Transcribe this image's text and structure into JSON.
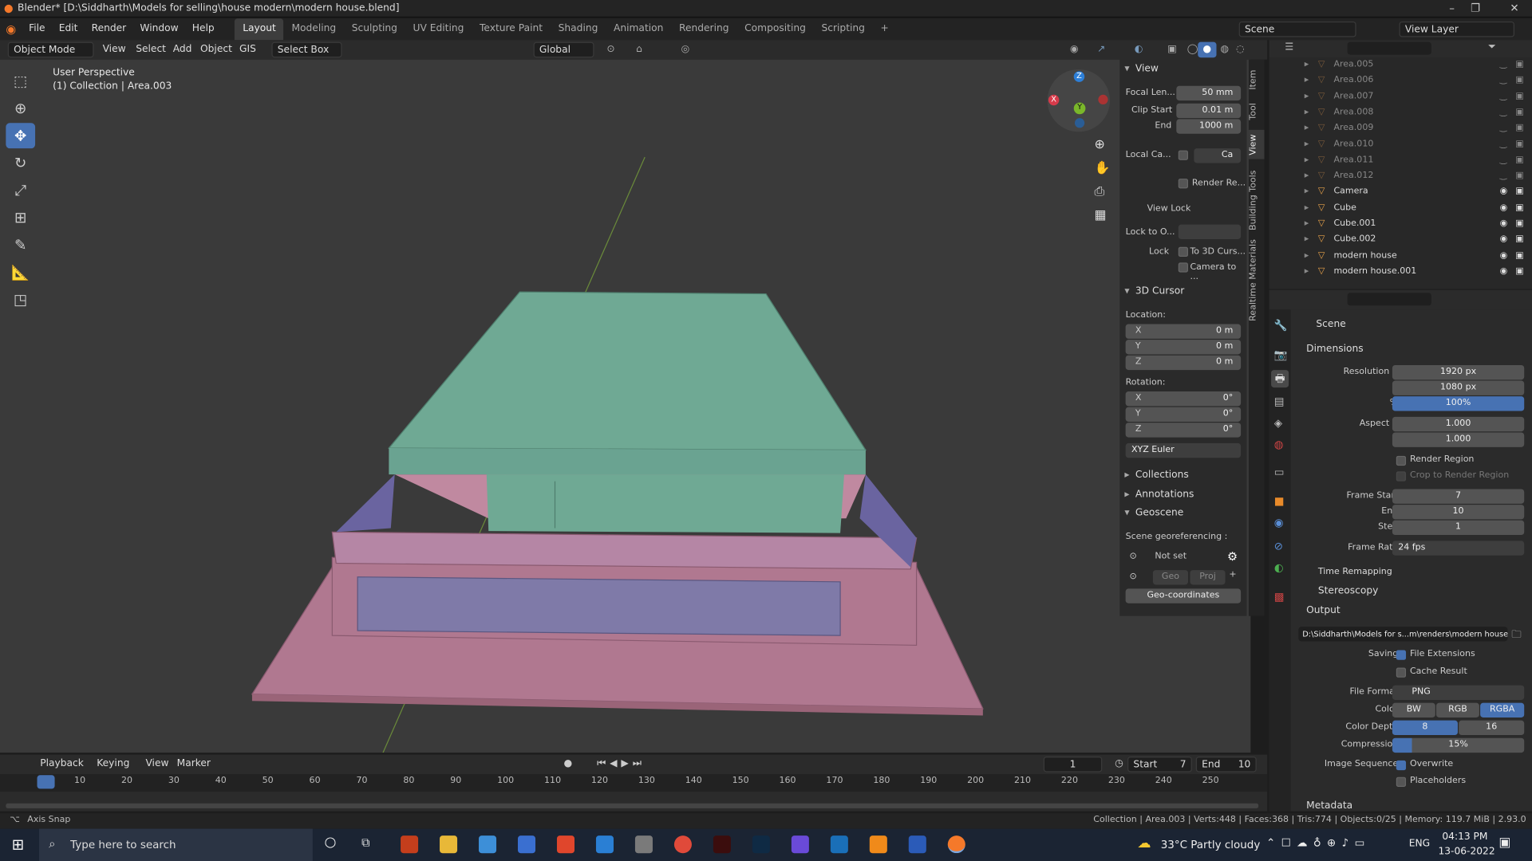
{
  "window": {
    "title": "Blender* [D:\\Siddharth\\Models for selling\\house modern\\modern house.blend]"
  },
  "menu": [
    "File",
    "Edit",
    "Render",
    "Window",
    "Help"
  ],
  "workspaces": [
    "Layout",
    "Modeling",
    "Sculpting",
    "UV Editing",
    "Texture Paint",
    "Shading",
    "Animation",
    "Rendering",
    "Compositing",
    "Scripting"
  ],
  "scene_label": "Scene",
  "view_layer_label": "View Layer",
  "header": {
    "mode": "Object Mode",
    "view": "View",
    "select": "Select",
    "add": "Add",
    "object": "Object",
    "gis": "GIS",
    "select_box": "Select Box",
    "orientation": "Global"
  },
  "viewport": {
    "perspective": "User Perspective",
    "collection": "(1) Collection | Area.003"
  },
  "npanel": {
    "tabs": [
      "Item",
      "Tool",
      "View",
      "Building Tools",
      "Realtime Materials"
    ],
    "view_title": "View",
    "focal_label": "Focal Len...",
    "focal": "50 mm",
    "clip_start_label": "Clip Start",
    "clip_start": "0.01 m",
    "end_label": "End",
    "clip_end": "1000 m",
    "local_cam_label": "Local Ca...",
    "local_cam_val": "Ca",
    "render_region": "Render Re...",
    "view_lock": "View Lock",
    "lock_to_label": "Lock to O...",
    "lock_label": "Lock",
    "to_cursor": "To 3D Curs...",
    "camera_to": "Camera to ...",
    "cursor_title": "3D Cursor",
    "location": "Location:",
    "rotation": "Rotation:",
    "x": "X",
    "y": "Y",
    "z": "Z",
    "zero_m": "0 m",
    "zero_deg": "0°",
    "euler": "XYZ Euler",
    "collections": "Collections",
    "annotations": "Annotations",
    "geoscene": "Geoscene",
    "georef": "Scene georeferencing :",
    "not_set": "Not set",
    "geo": "Geo",
    "proj": "Proj",
    "geo_coords": "Geo-coordinates"
  },
  "outliner": {
    "items": [
      {
        "name": "Area.005",
        "vis": false
      },
      {
        "name": "Area.006",
        "vis": false
      },
      {
        "name": "Area.007",
        "vis": false
      },
      {
        "name": "Area.008",
        "vis": false
      },
      {
        "name": "Area.009",
        "vis": false
      },
      {
        "name": "Area.010",
        "vis": false
      },
      {
        "name": "Area.011",
        "vis": false
      },
      {
        "name": "Area.012",
        "vis": false
      },
      {
        "name": "Camera",
        "vis": true
      },
      {
        "name": "Cube",
        "vis": true
      },
      {
        "name": "Cube.001",
        "vis": true
      },
      {
        "name": "Cube.002",
        "vis": true
      },
      {
        "name": "modern house",
        "vis": true
      },
      {
        "name": "modern house.001",
        "vis": true
      }
    ]
  },
  "props": {
    "scene": "Scene",
    "dimensions": "Dimensions",
    "res_x_label": "Resolution X",
    "res_x": "1920 px",
    "y_label": "Y",
    "res_y": "1080 px",
    "pct_label": "%",
    "pct": "100%",
    "aspect_x_label": "Aspect X",
    "aspect_x": "1.000",
    "aspect_y": "1.000",
    "render_region": "Render Region",
    "crop": "Crop to Render Region",
    "frame_start_label": "Frame Start",
    "frame_start": "7",
    "end_label": "End",
    "frame_end": "10",
    "step_label": "Step",
    "step": "1",
    "frame_rate_label": "Frame Rate",
    "frame_rate": "24 fps",
    "time_remap": "Time Remapping",
    "stereo": "Stereoscopy",
    "output": "Output",
    "path": "D:\\Siddharth\\Models for s...m\\renders\\modern house",
    "saving": "Saving",
    "file_ext": "File Extensions",
    "cache": "Cache Result",
    "file_format_label": "File Format",
    "file_format": "PNG",
    "color_label": "Color",
    "bw": "BW",
    "rgb": "RGB",
    "rgba": "RGBA",
    "depth_label": "Color Depth",
    "d8": "8",
    "d16": "16",
    "compression_label": "Compression",
    "compression": "15%",
    "imgseq_label": "Image Sequence",
    "overwrite": "Overwrite",
    "placeholders": "Placeholders",
    "metadata": "Metadata"
  },
  "timeline": {
    "playback": "Playback",
    "keying": "Keying",
    "view": "View",
    "marker": "Marker",
    "current": "1",
    "start_label": "Start",
    "start": "7",
    "end_label": "End",
    "end": "10",
    "ticks": [
      "1",
      "10",
      "20",
      "30",
      "40",
      "50",
      "60",
      "70",
      "80",
      "90",
      "100",
      "110",
      "120",
      "130",
      "140",
      "150",
      "160",
      "170",
      "180",
      "190",
      "200",
      "210",
      "220",
      "230",
      "240",
      "250"
    ]
  },
  "status": {
    "left": "Axis Snap",
    "right": "Collection | Area.003 | Verts:448 | Faces:368 | Tris:774 | Objects:0/25 | Memory: 119.7 MiB | 2.93.0"
  },
  "taskbar": {
    "search": "Type here to search",
    "weather": "33°C  Partly cloudy",
    "lang": "ENG",
    "time": "04:13 PM",
    "date": "13-06-2022"
  }
}
